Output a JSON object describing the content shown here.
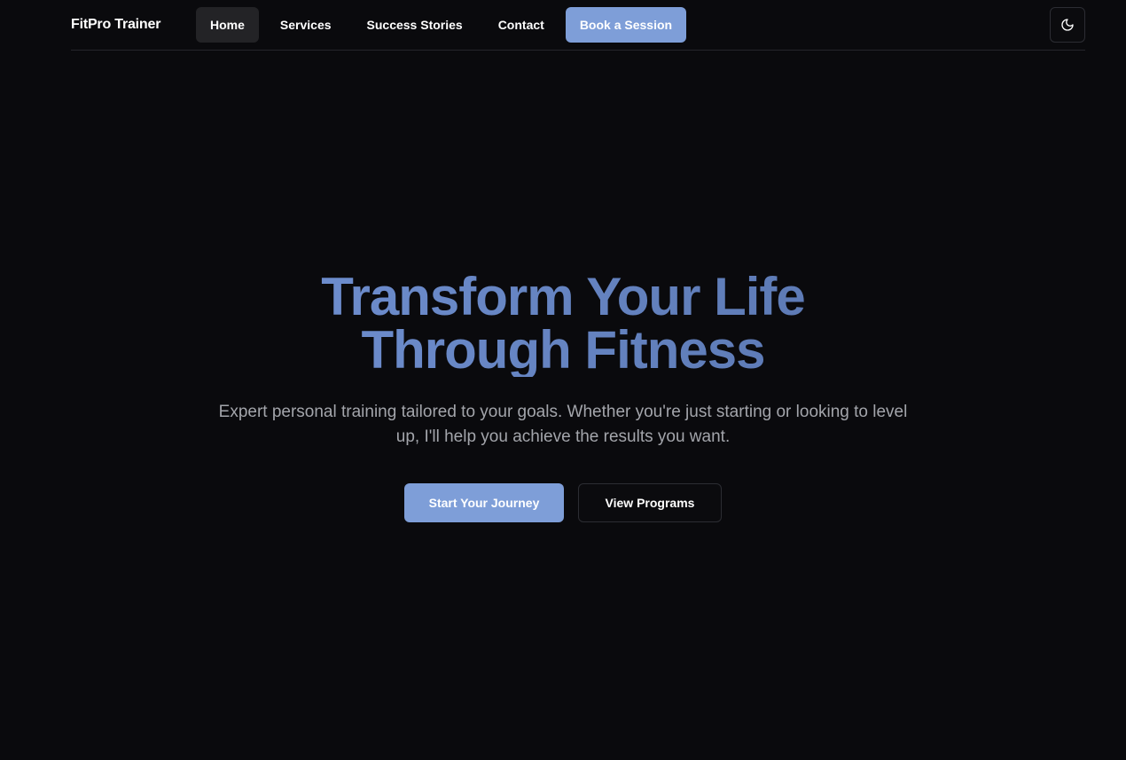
{
  "header": {
    "brand": "FitPro Trainer",
    "nav": [
      {
        "label": "Home",
        "active": true
      },
      {
        "label": "Services",
        "active": false
      },
      {
        "label": "Success Stories",
        "active": false
      },
      {
        "label": "Contact",
        "active": false
      }
    ],
    "cta_label": "Book a Session",
    "theme_toggle_icon": "moon-icon"
  },
  "hero": {
    "title": "Transform Your Life Through Fitness",
    "subtitle": "Expert personal training tailored to your goals. Whether you're just starting or looking to level up, I'll help you achieve the results you want.",
    "primary_button": "Start Your Journey",
    "secondary_button": "View Programs"
  },
  "colors": {
    "background": "#0a0a0d",
    "accent": "#7e9ed8",
    "title_gradient_start": "#6f8fd0",
    "title_gradient_end": "#5b78b2",
    "muted_text": "#a3a5ab"
  }
}
